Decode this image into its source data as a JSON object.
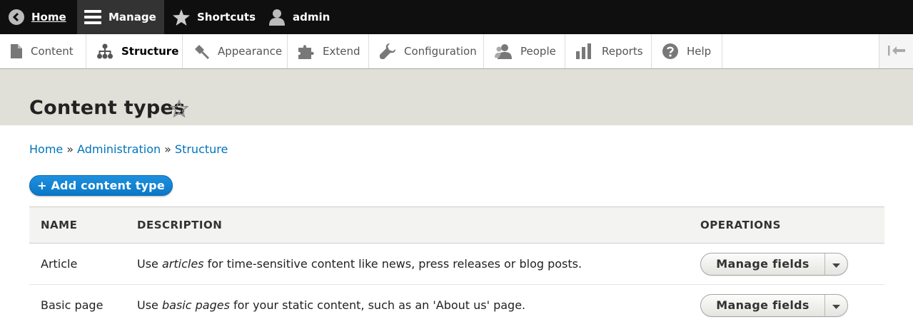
{
  "toolbar": {
    "home": "Home",
    "manage": "Manage",
    "shortcuts": "Shortcuts",
    "user": "admin"
  },
  "tray": {
    "items": [
      {
        "label": "Content",
        "icon": "file-icon"
      },
      {
        "label": "Structure",
        "icon": "sitemap-icon"
      },
      {
        "label": "Appearance",
        "icon": "paintbrush-icon"
      },
      {
        "label": "Extend",
        "icon": "puzzle-icon"
      },
      {
        "label": "Configuration",
        "icon": "wrench-icon"
      },
      {
        "label": "People",
        "icon": "people-icon"
      },
      {
        "label": "Reports",
        "icon": "bar-chart-icon"
      },
      {
        "label": "Help",
        "icon": "help-icon"
      }
    ]
  },
  "page": {
    "title": "Content types"
  },
  "breadcrumb": {
    "items": [
      "Home",
      "Administration",
      "Structure"
    ],
    "separator": "»"
  },
  "actions": {
    "add": "+ Add content type"
  },
  "table": {
    "headers": [
      "NAME",
      "DESCRIPTION",
      "OPERATIONS"
    ],
    "rows": [
      {
        "name": "Article",
        "desc_before": "Use ",
        "desc_em": "articles",
        "desc_after": " for time-sensitive content like news, press releases or blog posts.",
        "operation": "Manage fields"
      },
      {
        "name": "Basic page",
        "desc_before": "Use ",
        "desc_em": "basic pages",
        "desc_after": " for your static content, such as an 'About us' page.",
        "operation": "Manage fields"
      }
    ]
  },
  "colors": {
    "link": "#0074bd",
    "primary_button": "#1e90dd",
    "toolbar": "#0f0f0f",
    "header_band": "#e0e0d8"
  }
}
